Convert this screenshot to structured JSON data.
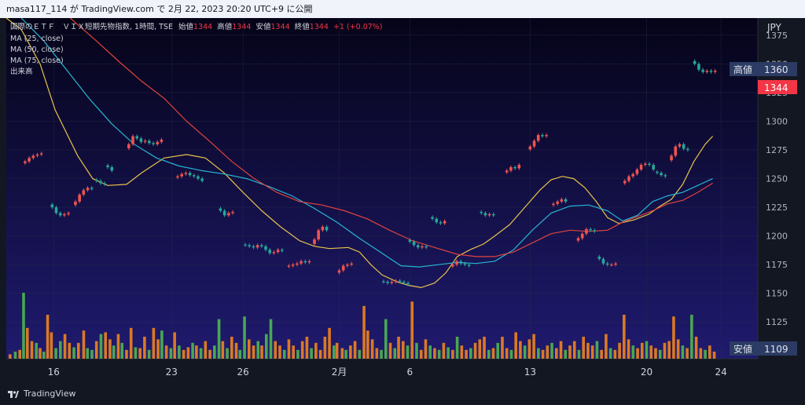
{
  "header": {
    "snapshot_text": "masa117_114 が TradingView.com で 2月 22, 2023 20:20 UTC+9 に公開"
  },
  "footer": {
    "brand": "TradingView"
  },
  "legend": {
    "title_line": "国際のＥＴＦ　ＶＩＸ短期先物指数, 1時間, TSE",
    "ohlc": [
      {
        "label": "始値",
        "value": "1344"
      },
      {
        "label": "高値",
        "value": "1344"
      },
      {
        "label": "安値",
        "value": "1344"
      },
      {
        "label": "終値",
        "value": "1344"
      }
    ],
    "change": "+1 (+0.07%)",
    "indicators": [
      "MA (25, close)",
      "MA (50, close)",
      "MA (75, close)",
      "出来高"
    ]
  },
  "price_scale": {
    "currency": "JPY",
    "ticks": [
      "1375",
      "1350",
      "1325",
      "1300",
      "1275",
      "1250",
      "1225",
      "1200",
      "1175",
      "1150",
      "1125",
      "1100"
    ],
    "tick_values": [
      1375,
      1350,
      1325,
      1300,
      1275,
      1250,
      1225,
      1200,
      1175,
      1150,
      1125,
      1100
    ],
    "high_label": "高値",
    "high_value": "1360",
    "last_value": "1344",
    "low_label": "安値",
    "low_value": "1109"
  },
  "time_axis": {
    "labels": [
      "16",
      "23",
      "26",
      "2月",
      "6",
      "13",
      "20",
      "24"
    ],
    "label_positions": [
      0.063,
      0.22,
      0.315,
      0.443,
      0.537,
      0.697,
      0.852,
      0.951
    ]
  },
  "colors": {
    "up": "#ef5350",
    "down": "#26a69a",
    "ma25": "#e8c34a",
    "ma50": "#26b6d2",
    "ma75": "#e0443c",
    "vol_up": "#e67e22",
    "vol_down": "#4caf50",
    "bg_top": "#050418",
    "bg_bottom": "#1f1a6e"
  },
  "chart_data": {
    "type": "candlestick",
    "title": "国際のＥＴＦ　ＶＩＸ短期先物指数, 1時間, TSE",
    "ylabel": "JPY",
    "ylim": [
      1093,
      1390
    ],
    "x_range": [
      0,
      1
    ],
    "sessions": [
      {
        "x": 0.025,
        "c": [
          1265,
          1268,
          1270,
          1271,
          1272
        ]
      },
      {
        "x": 0.061,
        "c": [
          1225,
          1220,
          1218,
          1219,
          1220
        ]
      },
      {
        "x": 0.092,
        "c": [
          1230,
          1236,
          1240,
          1242,
          1241
        ]
      },
      {
        "x": 0.12,
        "c": [
          1248,
          1246,
          1245
        ]
      },
      {
        "x": 0.135,
        "c": [
          1260,
          1257
        ]
      },
      {
        "x": 0.163,
        "c": [
          1280,
          1287,
          1285,
          1282,
          1283,
          1281,
          1280,
          1282,
          1284
        ]
      },
      {
        "x": 0.228,
        "c": [
          1252,
          1254,
          1255,
          1253,
          1252,
          1250,
          1248
        ]
      },
      {
        "x": 0.285,
        "c": [
          1222,
          1218,
          1220,
          1221
        ]
      },
      {
        "x": 0.318,
        "c": [
          1192,
          1191,
          1190,
          1192,
          1191,
          1188,
          1185,
          1186,
          1188,
          1187
        ]
      },
      {
        "x": 0.376,
        "c": [
          1174,
          1175,
          1176,
          1178,
          1177,
          1178
        ]
      },
      {
        "x": 0.41,
        "c": [
          1197,
          1205,
          1208,
          1205
        ]
      },
      {
        "x": 0.443,
        "c": [
          1170,
          1174,
          1175,
          1176
        ]
      },
      {
        "x": 0.502,
        "c": [
          1160,
          1159,
          1160,
          1161,
          1160,
          1159,
          1158
        ]
      },
      {
        "x": 0.537,
        "c": [
          1195,
          1192,
          1190,
          1191,
          1190
        ]
      },
      {
        "x": 0.567,
        "c": [
          1215,
          1212,
          1211,
          1213
        ]
      },
      {
        "x": 0.594,
        "c": [
          1175,
          1178,
          1176,
          1175,
          1174
        ]
      },
      {
        "x": 0.632,
        "c": [
          1220,
          1218,
          1219,
          1218
        ]
      },
      {
        "x": 0.666,
        "c": [
          1257,
          1260,
          1259,
          1262
        ]
      },
      {
        "x": 0.697,
        "c": [
          1278,
          1283,
          1288,
          1287,
          1288
        ]
      },
      {
        "x": 0.728,
        "c": [
          1228,
          1230,
          1232,
          1230
        ]
      },
      {
        "x": 0.761,
        "c": [
          1198,
          1202,
          1206,
          1205,
          1204
        ]
      },
      {
        "x": 0.789,
        "c": [
          1180,
          1176,
          1175,
          1175,
          1176
        ]
      },
      {
        "x": 0.823,
        "c": [
          1248,
          1252,
          1254,
          1258,
          1262,
          1263,
          1262,
          1258
        ]
      },
      {
        "x": 0.866,
        "c": [
          1255,
          1253,
          1252
        ]
      },
      {
        "x": 0.885,
        "c": [
          1270,
          1278,
          1280,
          1276,
          1275
        ]
      },
      {
        "x": 0.916,
        "c": [
          1350,
          1345,
          1343,
          1344,
          1343,
          1344
        ]
      }
    ],
    "ma25": [
      [
        0,
        1390
      ],
      [
        0.02,
        1380
      ],
      [
        0.045,
        1350
      ],
      [
        0.065,
        1310
      ],
      [
        0.095,
        1270
      ],
      [
        0.115,
        1250
      ],
      [
        0.135,
        1244
      ],
      [
        0.16,
        1245
      ],
      [
        0.18,
        1255
      ],
      [
        0.21,
        1268
      ],
      [
        0.24,
        1271
      ],
      [
        0.265,
        1268
      ],
      [
        0.29,
        1255
      ],
      [
        0.315,
        1238
      ],
      [
        0.34,
        1222
      ],
      [
        0.365,
        1208
      ],
      [
        0.39,
        1196
      ],
      [
        0.41,
        1191
      ],
      [
        0.43,
        1189
      ],
      [
        0.455,
        1190
      ],
      [
        0.47,
        1186
      ],
      [
        0.485,
        1175
      ],
      [
        0.5,
        1166
      ],
      [
        0.52,
        1160
      ],
      [
        0.535,
        1157
      ],
      [
        0.552,
        1155
      ],
      [
        0.57,
        1159
      ],
      [
        0.585,
        1168
      ],
      [
        0.6,
        1182
      ],
      [
        0.617,
        1188
      ],
      [
        0.635,
        1193
      ],
      [
        0.65,
        1200
      ],
      [
        0.67,
        1210
      ],
      [
        0.69,
        1225
      ],
      [
        0.71,
        1240
      ],
      [
        0.725,
        1249
      ],
      [
        0.74,
        1252
      ],
      [
        0.755,
        1250
      ],
      [
        0.77,
        1242
      ],
      [
        0.785,
        1230
      ],
      [
        0.8,
        1216
      ],
      [
        0.815,
        1211
      ],
      [
        0.835,
        1214
      ],
      [
        0.855,
        1219
      ],
      [
        0.87,
        1226
      ],
      [
        0.885,
        1232
      ],
      [
        0.9,
        1245
      ],
      [
        0.915,
        1265
      ],
      [
        0.93,
        1280
      ],
      [
        0.94,
        1287
      ]
    ],
    "ma50": [
      [
        0.02,
        1390
      ],
      [
        0.05,
        1370
      ],
      [
        0.08,
        1345
      ],
      [
        0.11,
        1320
      ],
      [
        0.14,
        1298
      ],
      [
        0.17,
        1280
      ],
      [
        0.2,
        1268
      ],
      [
        0.23,
        1261
      ],
      [
        0.26,
        1257
      ],
      [
        0.29,
        1254
      ],
      [
        0.32,
        1250
      ],
      [
        0.35,
        1243
      ],
      [
        0.38,
        1235
      ],
      [
        0.41,
        1224
      ],
      [
        0.44,
        1212
      ],
      [
        0.47,
        1198
      ],
      [
        0.5,
        1185
      ],
      [
        0.525,
        1174
      ],
      [
        0.55,
        1173
      ],
      [
        0.575,
        1175
      ],
      [
        0.6,
        1177
      ],
      [
        0.625,
        1176
      ],
      [
        0.65,
        1178
      ],
      [
        0.675,
        1188
      ],
      [
        0.7,
        1205
      ],
      [
        0.725,
        1220
      ],
      [
        0.75,
        1226
      ],
      [
        0.775,
        1227
      ],
      [
        0.8,
        1222
      ],
      [
        0.82,
        1213
      ],
      [
        0.84,
        1218
      ],
      [
        0.86,
        1230
      ],
      [
        0.88,
        1235
      ],
      [
        0.9,
        1238
      ],
      [
        0.92,
        1244
      ],
      [
        0.94,
        1250
      ]
    ],
    "ma75": [
      [
        0.085,
        1390
      ],
      [
        0.12,
        1370
      ],
      [
        0.15,
        1352
      ],
      [
        0.18,
        1335
      ],
      [
        0.21,
        1320
      ],
      [
        0.24,
        1300
      ],
      [
        0.27,
        1283
      ],
      [
        0.3,
        1265
      ],
      [
        0.33,
        1250
      ],
      [
        0.36,
        1238
      ],
      [
        0.39,
        1230
      ],
      [
        0.42,
        1227
      ],
      [
        0.45,
        1222
      ],
      [
        0.48,
        1215
      ],
      [
        0.51,
        1205
      ],
      [
        0.54,
        1196
      ],
      [
        0.57,
        1190
      ],
      [
        0.6,
        1184
      ],
      [
        0.625,
        1182
      ],
      [
        0.65,
        1182
      ],
      [
        0.675,
        1186
      ],
      [
        0.7,
        1194
      ],
      [
        0.725,
        1202
      ],
      [
        0.75,
        1205
      ],
      [
        0.775,
        1204
      ],
      [
        0.8,
        1205
      ],
      [
        0.82,
        1212
      ],
      [
        0.84,
        1217
      ],
      [
        0.86,
        1222
      ],
      [
        0.88,
        1228
      ],
      [
        0.9,
        1231
      ],
      [
        0.92,
        1238
      ],
      [
        0.94,
        1246
      ]
    ],
    "volume": [
      [
        0.005,
        0.05,
        1
      ],
      [
        0.012,
        0.08,
        0
      ],
      [
        0.018,
        0.1,
        1
      ],
      [
        0.023,
        0.75,
        0
      ],
      [
        0.028,
        0.35,
        1
      ],
      [
        0.034,
        0.2,
        1
      ],
      [
        0.04,
        0.18,
        0
      ],
      [
        0.045,
        0.12,
        1
      ],
      [
        0.05,
        0.08,
        0
      ],
      [
        0.055,
        0.5,
        1
      ],
      [
        0.06,
        0.3,
        1
      ],
      [
        0.066,
        0.12,
        0
      ],
      [
        0.072,
        0.2,
        0
      ],
      [
        0.078,
        0.28,
        1
      ],
      [
        0.084,
        0.18,
        1
      ],
      [
        0.09,
        0.13,
        0
      ],
      [
        0.096,
        0.18,
        1
      ],
      [
        0.103,
        0.32,
        1
      ],
      [
        0.108,
        0.12,
        0
      ],
      [
        0.114,
        0.1,
        0
      ],
      [
        0.12,
        0.2,
        1
      ],
      [
        0.126,
        0.28,
        0
      ],
      [
        0.132,
        0.3,
        1
      ],
      [
        0.138,
        0.22,
        1
      ],
      [
        0.143,
        0.15,
        0
      ],
      [
        0.149,
        0.28,
        1
      ],
      [
        0.154,
        0.18,
        0
      ],
      [
        0.16,
        0.1,
        1
      ],
      [
        0.166,
        0.35,
        1
      ],
      [
        0.172,
        0.13,
        0
      ],
      [
        0.178,
        0.12,
        1
      ],
      [
        0.184,
        0.25,
        1
      ],
      [
        0.19,
        0.1,
        0
      ],
      [
        0.196,
        0.35,
        1
      ],
      [
        0.202,
        0.22,
        1
      ],
      [
        0.207,
        0.32,
        0
      ],
      [
        0.213,
        0.15,
        1
      ],
      [
        0.219,
        0.12,
        0
      ],
      [
        0.224,
        0.3,
        1
      ],
      [
        0.23,
        0.15,
        0
      ],
      [
        0.236,
        0.1,
        1
      ],
      [
        0.242,
        0.13,
        1
      ],
      [
        0.248,
        0.18,
        0
      ],
      [
        0.253,
        0.15,
        1
      ],
      [
        0.259,
        0.12,
        0
      ],
      [
        0.265,
        0.2,
        1
      ],
      [
        0.271,
        0.1,
        1
      ],
      [
        0.277,
        0.15,
        0
      ],
      [
        0.283,
        0.45,
        0
      ],
      [
        0.288,
        0.2,
        1
      ],
      [
        0.294,
        0.12,
        0
      ],
      [
        0.3,
        0.25,
        1
      ],
      [
        0.306,
        0.18,
        1
      ],
      [
        0.311,
        0.1,
        0
      ],
      [
        0.317,
        0.48,
        0
      ],
      [
        0.323,
        0.22,
        1
      ],
      [
        0.329,
        0.15,
        1
      ],
      [
        0.335,
        0.2,
        0
      ],
      [
        0.34,
        0.15,
        1
      ],
      [
        0.346,
        0.28,
        0
      ],
      [
        0.352,
        0.45,
        0
      ],
      [
        0.358,
        0.2,
        1
      ],
      [
        0.364,
        0.15,
        1
      ],
      [
        0.37,
        0.1,
        0
      ],
      [
        0.376,
        0.22,
        1
      ],
      [
        0.382,
        0.15,
        1
      ],
      [
        0.388,
        0.1,
        0
      ],
      [
        0.394,
        0.2,
        1
      ],
      [
        0.4,
        0.25,
        1
      ],
      [
        0.406,
        0.12,
        0
      ],
      [
        0.412,
        0.18,
        1
      ],
      [
        0.418,
        0.1,
        1
      ],
      [
        0.424,
        0.25,
        1
      ],
      [
        0.43,
        0.35,
        1
      ],
      [
        0.436,
        0.15,
        0
      ],
      [
        0.44,
        0.18,
        1
      ],
      [
        0.447,
        0.12,
        1
      ],
      [
        0.452,
        0.1,
        0
      ],
      [
        0.458,
        0.15,
        1
      ],
      [
        0.464,
        0.2,
        1
      ],
      [
        0.47,
        0.1,
        0
      ],
      [
        0.476,
        0.6,
        1
      ],
      [
        0.481,
        0.32,
        1
      ],
      [
        0.487,
        0.22,
        1
      ],
      [
        0.493,
        0.12,
        1
      ],
      [
        0.499,
        0.1,
        0
      ],
      [
        0.505,
        0.45,
        0
      ],
      [
        0.511,
        0.18,
        1
      ],
      [
        0.517,
        0.12,
        0
      ],
      [
        0.522,
        0.25,
        1
      ],
      [
        0.528,
        0.2,
        1
      ],
      [
        0.534,
        0.15,
        0
      ],
      [
        0.54,
        0.65,
        1
      ],
      [
        0.546,
        0.18,
        0
      ],
      [
        0.552,
        0.1,
        1
      ],
      [
        0.558,
        0.22,
        1
      ],
      [
        0.564,
        0.15,
        0
      ],
      [
        0.57,
        0.12,
        1
      ],
      [
        0.576,
        0.1,
        0
      ],
      [
        0.582,
        0.18,
        1
      ],
      [
        0.588,
        0.13,
        0
      ],
      [
        0.594,
        0.1,
        1
      ],
      [
        0.6,
        0.25,
        0
      ],
      [
        0.606,
        0.15,
        1
      ],
      [
        0.612,
        0.1,
        1
      ],
      [
        0.618,
        0.12,
        0
      ],
      [
        0.624,
        0.18,
        1
      ],
      [
        0.63,
        0.22,
        1
      ],
      [
        0.636,
        0.25,
        1
      ],
      [
        0.642,
        0.1,
        0
      ],
      [
        0.648,
        0.12,
        1
      ],
      [
        0.654,
        0.18,
        0
      ],
      [
        0.66,
        0.25,
        1
      ],
      [
        0.666,
        0.12,
        1
      ],
      [
        0.672,
        0.1,
        0
      ],
      [
        0.678,
        0.3,
        1
      ],
      [
        0.684,
        0.2,
        1
      ],
      [
        0.69,
        0.15,
        0
      ],
      [
        0.696,
        0.22,
        1
      ],
      [
        0.702,
        0.28,
        1
      ],
      [
        0.708,
        0.12,
        0
      ],
      [
        0.714,
        0.1,
        1
      ],
      [
        0.72,
        0.15,
        1
      ],
      [
        0.726,
        0.18,
        0
      ],
      [
        0.732,
        0.12,
        1
      ],
      [
        0.738,
        0.2,
        1
      ],
      [
        0.744,
        0.1,
        0
      ],
      [
        0.75,
        0.15,
        1
      ],
      [
        0.756,
        0.2,
        1
      ],
      [
        0.762,
        0.1,
        0
      ],
      [
        0.768,
        0.25,
        1
      ],
      [
        0.774,
        0.18,
        1
      ],
      [
        0.78,
        0.15,
        1
      ],
      [
        0.786,
        0.2,
        0
      ],
      [
        0.792,
        0.1,
        1
      ],
      [
        0.798,
        0.28,
        1
      ],
      [
        0.804,
        0.12,
        0
      ],
      [
        0.81,
        0.1,
        1
      ],
      [
        0.816,
        0.18,
        1
      ],
      [
        0.822,
        0.5,
        1
      ],
      [
        0.828,
        0.22,
        1
      ],
      [
        0.834,
        0.15,
        0
      ],
      [
        0.84,
        0.12,
        1
      ],
      [
        0.846,
        0.18,
        1
      ],
      [
        0.852,
        0.2,
        0
      ],
      [
        0.858,
        0.15,
        1
      ],
      [
        0.864,
        0.12,
        1
      ],
      [
        0.87,
        0.1,
        0
      ],
      [
        0.876,
        0.18,
        1
      ],
      [
        0.882,
        0.2,
        1
      ],
      [
        0.888,
        0.48,
        1
      ],
      [
        0.894,
        0.22,
        1
      ],
      [
        0.9,
        0.15,
        0
      ],
      [
        0.906,
        0.12,
        1
      ],
      [
        0.912,
        0.5,
        0
      ],
      [
        0.918,
        0.25,
        1
      ],
      [
        0.924,
        0.12,
        1
      ],
      [
        0.93,
        0.1,
        0
      ],
      [
        0.936,
        0.15,
        1
      ],
      [
        0.942,
        0.08,
        1
      ]
    ]
  }
}
